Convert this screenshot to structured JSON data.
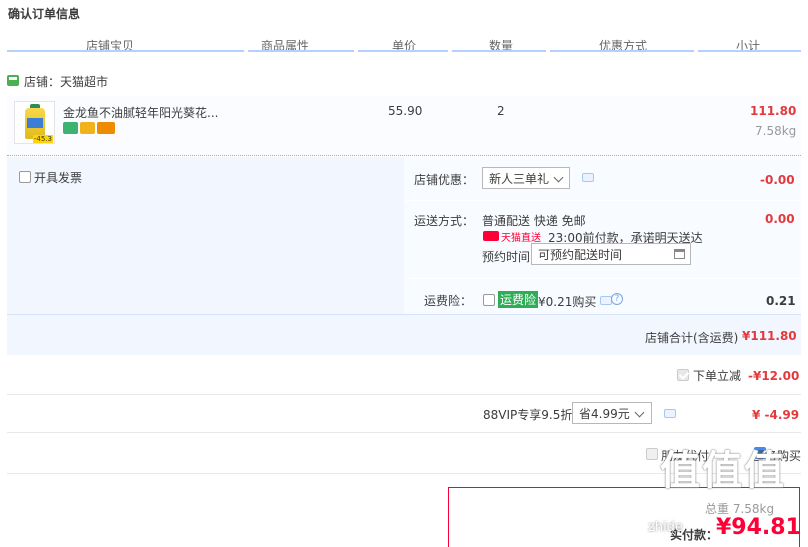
{
  "header": {
    "title": "确认订单信息"
  },
  "columns": [
    "店铺宝贝",
    "商品属性",
    "单价",
    "数量",
    "优惠方式",
    "小计"
  ],
  "shop": {
    "label": "店铺：天猫超市"
  },
  "item": {
    "name": "金龙鱼不油腻轻年阳光葵花...",
    "price": "55.90",
    "quantity": "2",
    "subtotal": "111.80",
    "weight": "7.58kg",
    "thumb_badge": "-45.3"
  },
  "invoice": {
    "label": "开具发票"
  },
  "shop_discount": {
    "label": "店铺优惠：",
    "selected": "新人三单礼",
    "value": "-0.00"
  },
  "shipping": {
    "label": "运送方式：",
    "method": "普通配送 快递 免邮",
    "value": "0.00",
    "tmall_tag": "天猫直送",
    "promise": "23:00前付款，承诺明天送达",
    "appointment_label": "预约时间",
    "appointment_placeholder": "可预约配送时间"
  },
  "insurance": {
    "label": "运费险：",
    "tag": "运费险",
    "price": "¥0.21购买",
    "value": "0.21"
  },
  "shop_total": {
    "label": "店铺合计(含运费)",
    "value": "¥111.80"
  },
  "instant_discount": {
    "label": "下单立减",
    "value": "-¥12.00"
  },
  "vip": {
    "label": "88VIP专享9.5折",
    "selected": "省4.99元",
    "value": "¥ -4.99"
  },
  "options": {
    "friend_pay": "朋友代付",
    "anonymous": "匿名购买"
  },
  "payment": {
    "weight_label": "总重 7.58kg",
    "pay_label": "实付款：",
    "pay_value": "¥94.81"
  },
  "watermark": {
    "text": "值值值",
    "sub": "zhide"
  },
  "colors": {
    "accent_red": "#e4393c",
    "tmall_red": "#ff0036",
    "header_line": "#b2d1ff",
    "detail_bg": "#f2f7ff"
  }
}
